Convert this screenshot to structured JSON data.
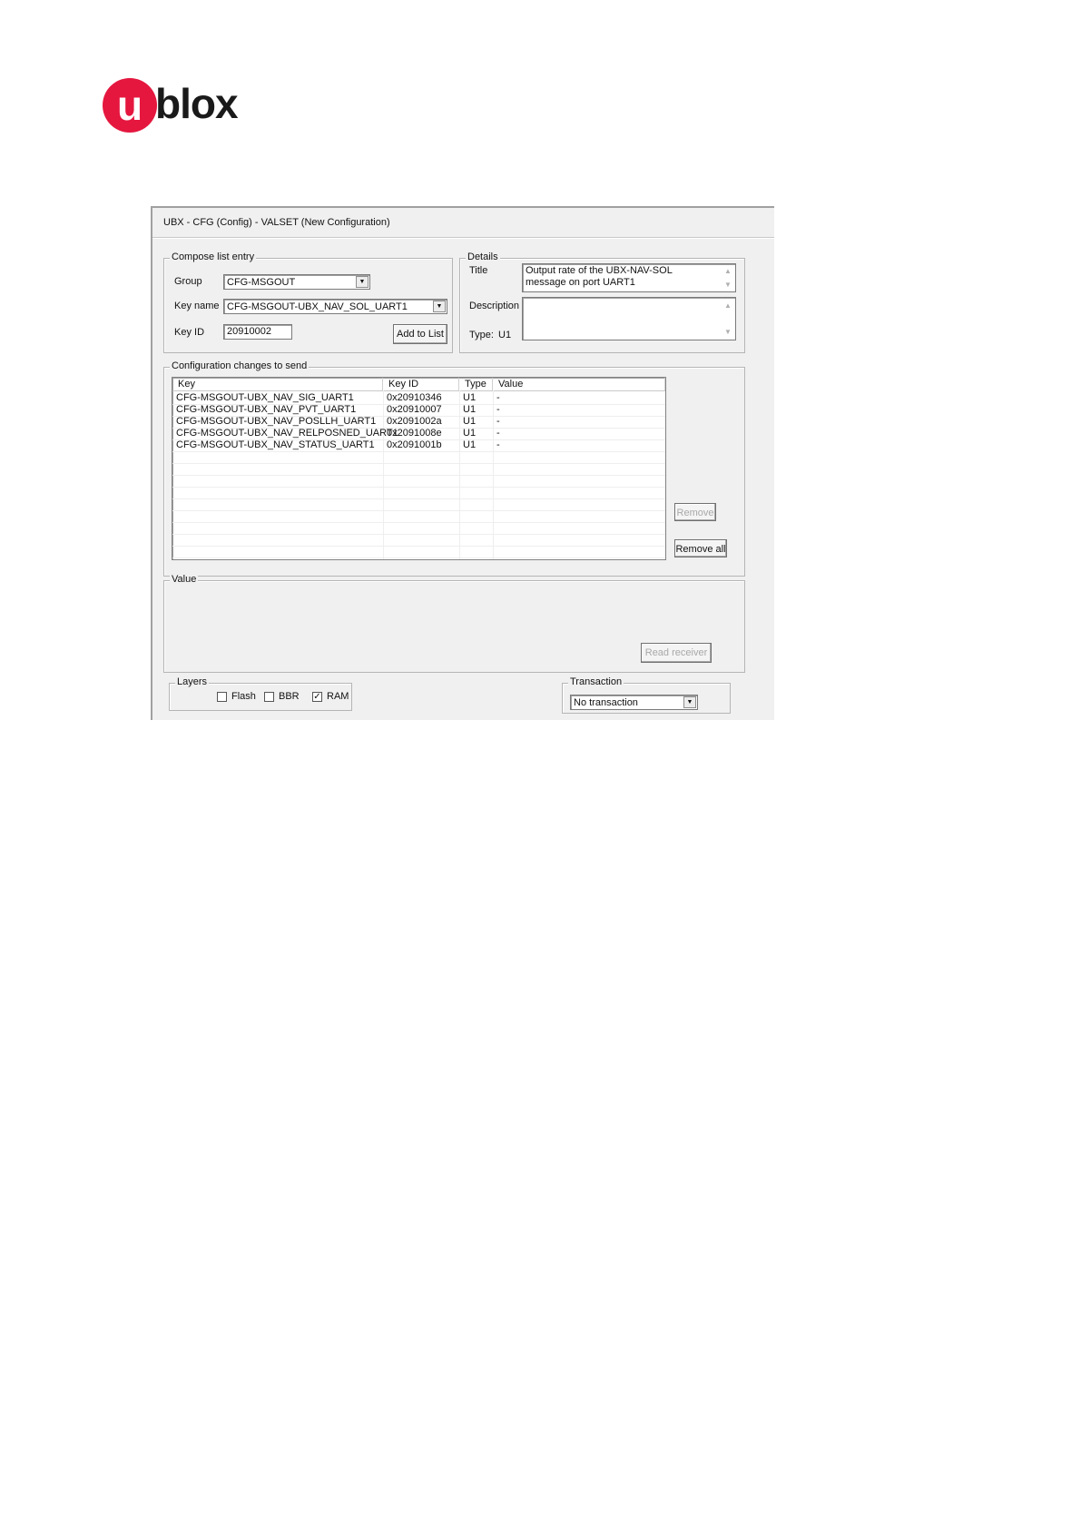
{
  "logo": {
    "text_u": "u",
    "text_rest": "blox",
    "brand_color": "#e5173f"
  },
  "window": {
    "title": "UBX - CFG (Config) - VALSET (New Configuration)"
  },
  "compose": {
    "legend": "Compose list entry",
    "group_label": "Group",
    "group_value": "CFG-MSGOUT",
    "keyname_label": "Key name",
    "keyname_value": "CFG-MSGOUT-UBX_NAV_SOL_UART1",
    "keyid_label": "Key ID",
    "keyid_value": "20910002",
    "add_button": "Add to List"
  },
  "details": {
    "legend": "Details",
    "title_label": "Title",
    "title_value": "Output rate of the UBX-NAV-SOL message on port UART1",
    "description_label": "Description",
    "description_value": "",
    "type_label": "Type:",
    "type_value": "U1"
  },
  "changes": {
    "legend": "Configuration changes to send",
    "columns": [
      "Key",
      "Key ID",
      "Type",
      "Value"
    ],
    "rows": [
      {
        "key": "CFG-MSGOUT-UBX_NAV_SIG_UART1",
        "keyid": "0x20910346",
        "type": "U1",
        "value": "-"
      },
      {
        "key": "CFG-MSGOUT-UBX_NAV_PVT_UART1",
        "keyid": "0x20910007",
        "type": "U1",
        "value": "-"
      },
      {
        "key": "CFG-MSGOUT-UBX_NAV_POSLLH_UART1",
        "keyid": "0x2091002a",
        "type": "U1",
        "value": "-"
      },
      {
        "key": "CFG-MSGOUT-UBX_NAV_RELPOSNED_UART1",
        "keyid": "0x2091008e",
        "type": "U1",
        "value": "-"
      },
      {
        "key": "CFG-MSGOUT-UBX_NAV_STATUS_UART1",
        "keyid": "0x2091001b",
        "type": "U1",
        "value": "-"
      }
    ],
    "remove_button": "Remove",
    "remove_all_button": "Remove all"
  },
  "value_group": {
    "legend": "Value",
    "read_receiver_button": "Read receiver"
  },
  "layers": {
    "legend": "Layers",
    "flash_label": "Flash",
    "flash_checked": false,
    "bbr_label": "BBR",
    "bbr_checked": false,
    "ram_label": "RAM",
    "ram_checked": true
  },
  "transaction": {
    "legend": "Transaction",
    "value": "No transaction"
  }
}
